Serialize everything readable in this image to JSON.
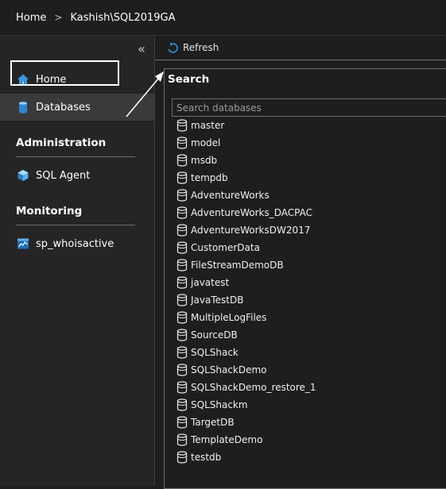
{
  "breadcrumb": {
    "home": "Home",
    "separator": ">",
    "current": "Kashish\\SQL2019GA"
  },
  "sidebar": {
    "collapse_glyph": "«",
    "items": [
      {
        "label": "Home",
        "icon": "home-icon"
      },
      {
        "label": "Databases",
        "icon": "database-icon",
        "selected": true
      }
    ],
    "sections": [
      {
        "title": "Administration",
        "items": [
          {
            "label": "SQL Agent",
            "icon": "sql-agent-icon"
          }
        ]
      },
      {
        "title": "Monitoring",
        "items": [
          {
            "label": "sp_whoisactive",
            "icon": "chart-icon"
          }
        ]
      }
    ]
  },
  "toolbar": {
    "refresh_label": "Refresh"
  },
  "search": {
    "title": "Search",
    "placeholder": "Search databases",
    "databases": [
      "master",
      "model",
      "msdb",
      "tempdb",
      "AdventureWorks",
      "AdventureWorks_DACPAC",
      "AdventureWorksDW2017",
      "CustomerData",
      "FileStreamDemoDB",
      "javatest",
      "JavaTestDB",
      "MultipleLogFiles",
      "SourceDB",
      "SQLShack",
      "SQLShackDemo",
      "SQLShackDemo_restore_1",
      "SQLShackm",
      "TargetDB",
      "TemplateDemo",
      "testdb"
    ]
  },
  "colors": {
    "background": "#1e1e1e",
    "sidebar": "#252526",
    "selected": "#3a3a3a",
    "accent": "#3a96dd"
  }
}
